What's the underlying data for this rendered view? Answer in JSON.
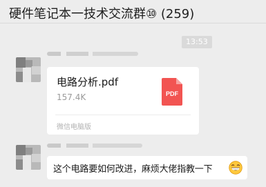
{
  "header": {
    "title": "硬件笔记本一技术交流群⑩ (259)"
  },
  "timestamp": "13:53",
  "messages": {
    "file": {
      "name": "电路分析.pdf",
      "size": "157.4K",
      "icon_label": "PDF",
      "icon_color": "#f25452",
      "source": "微信电脑版"
    },
    "text": {
      "content": "这个电路要如何改进，麻烦大佬指教一下",
      "emoji": "grinning-face-emoji"
    }
  }
}
